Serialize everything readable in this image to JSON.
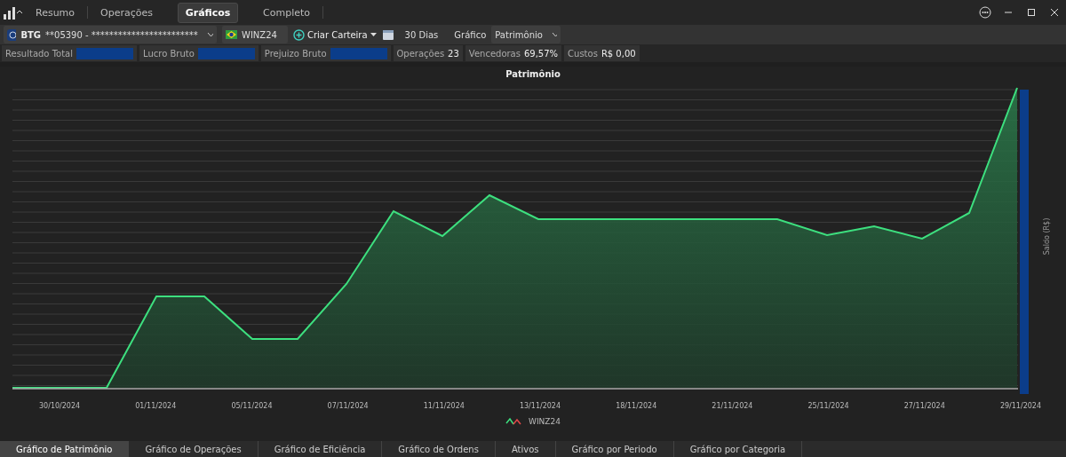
{
  "tabs": [
    {
      "label": "Resumo",
      "selected": false
    },
    {
      "label": "Operações",
      "selected": false
    },
    {
      "label": "Gráficos",
      "selected": true
    },
    {
      "label": "Completo",
      "selected": false
    }
  ],
  "toolbar": {
    "broker": "BTG",
    "account": "**05390 - ************************",
    "asset": "WINZ24",
    "create_portfolio": "Criar Carteira",
    "period": "30 Dias",
    "chart_label": "Gráfico",
    "chart_select": "Patrimônio"
  },
  "stats": [
    {
      "label": "Resultado Total",
      "redacted": true
    },
    {
      "label": "Lucro Bruto",
      "redacted": true
    },
    {
      "label": "Prejuizo Bruto",
      "redacted": true
    },
    {
      "label": "Operações",
      "value": "23",
      "redacted": false
    },
    {
      "label": "Vencedoras",
      "value": "69,57%",
      "redacted": false
    },
    {
      "label": "Custos",
      "value": "R$ 0,00",
      "redacted": false
    }
  ],
  "chart": {
    "title": "Patrimônio",
    "ylabel": "Saldo (R$)",
    "x_labels": [
      "30/10/2024",
      "01/11/2024",
      "05/11/2024",
      "07/11/2024",
      "11/11/2024",
      "13/11/2024",
      "18/11/2024",
      "21/11/2024",
      "25/11/2024",
      "27/11/2024",
      "29/11/2024"
    ],
    "legend": "WINZ24"
  },
  "bottom_tabs": [
    {
      "label": "Gráfico de Patrimônio",
      "selected": true
    },
    {
      "label": "Gráfico de Operações",
      "selected": false
    },
    {
      "label": "Gráfico de Eficiência",
      "selected": false
    },
    {
      "label": "Gráfico de Ordens",
      "selected": false
    },
    {
      "label": "Ativos",
      "selected": false
    },
    {
      "label": "Gráfico por Periodo",
      "selected": false
    },
    {
      "label": "Gráfico por Categoria",
      "selected": false
    }
  ]
}
